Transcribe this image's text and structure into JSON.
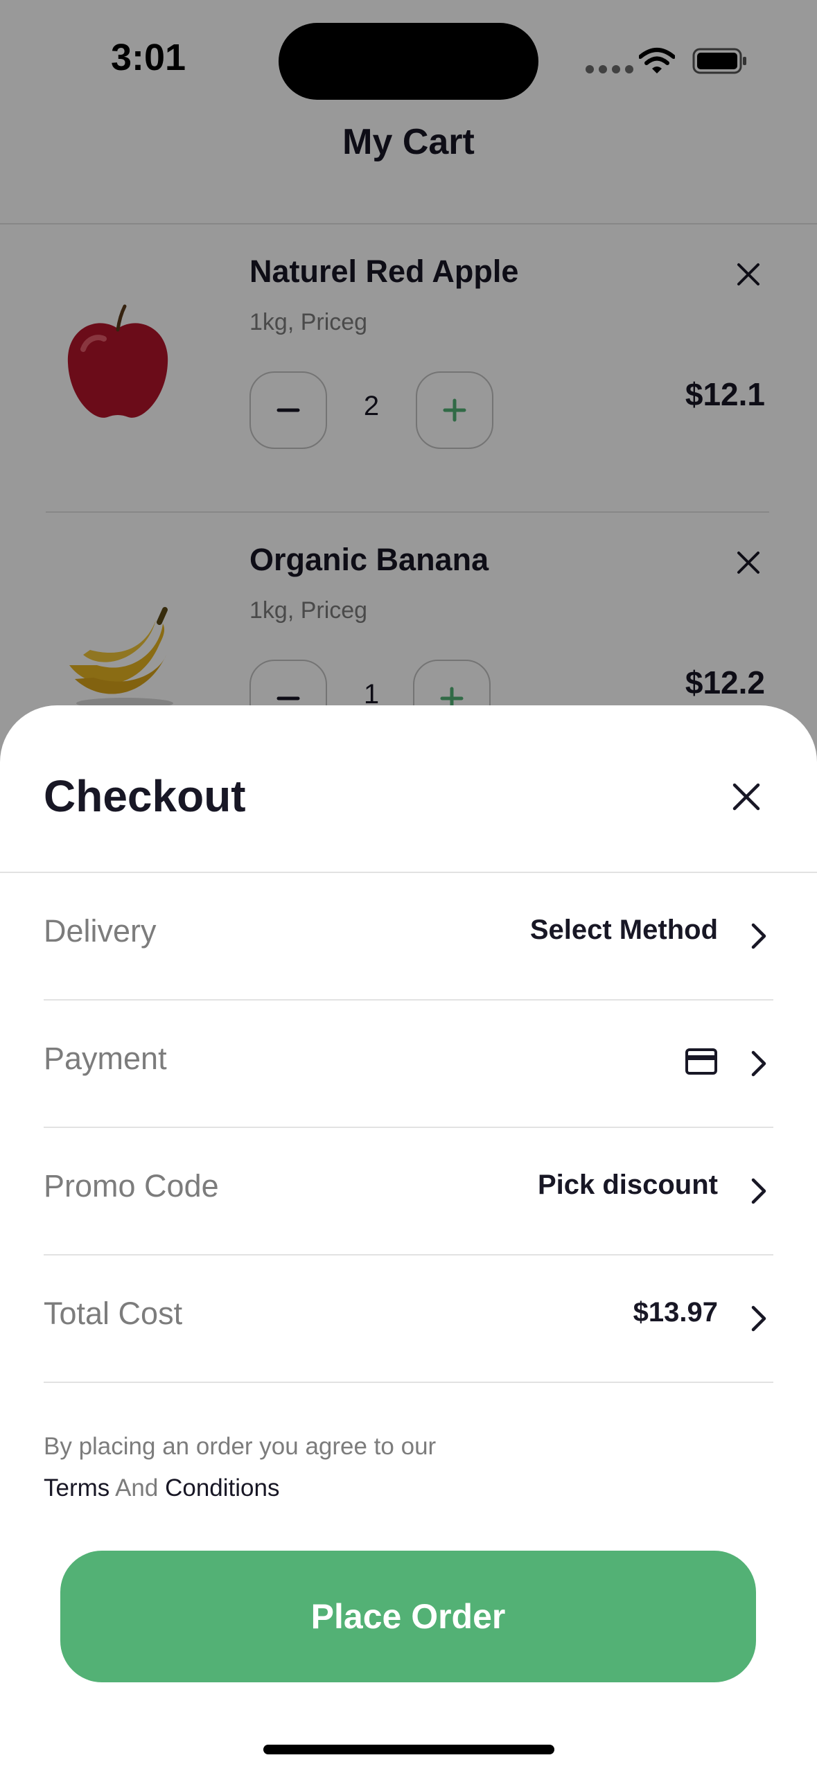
{
  "status_bar": {
    "time": "3:01"
  },
  "cart": {
    "title": "My Cart",
    "items": [
      {
        "name": "Naturel Red Apple",
        "meta": "1kg, Priceg",
        "quantity": "2",
        "price": "$12.1",
        "image_icon": "red-apple-image"
      },
      {
        "name": "Organic Banana",
        "meta": "1kg, Priceg",
        "quantity": "1",
        "price": "$12.2",
        "image_icon": "banana-image"
      }
    ]
  },
  "checkout": {
    "title": "Checkout",
    "rows": [
      {
        "label": "Delivery",
        "value": "Select Method"
      },
      {
        "label": "Payment",
        "value_icon": "credit-card-icon"
      },
      {
        "label": "Promo Code",
        "value": "Pick discount"
      },
      {
        "label": "Total Cost",
        "value": "$13.97"
      }
    ],
    "terms": {
      "prefix": "By placing an order you agree to our",
      "terms": "Terms",
      "and": "And",
      "conditions": "Conditions"
    },
    "place_order_label": "Place Order"
  },
  "colors": {
    "accent": "#53b175",
    "text_primary": "#181725",
    "text_secondary": "#7c7c7c",
    "divider": "#e2e2e2"
  }
}
